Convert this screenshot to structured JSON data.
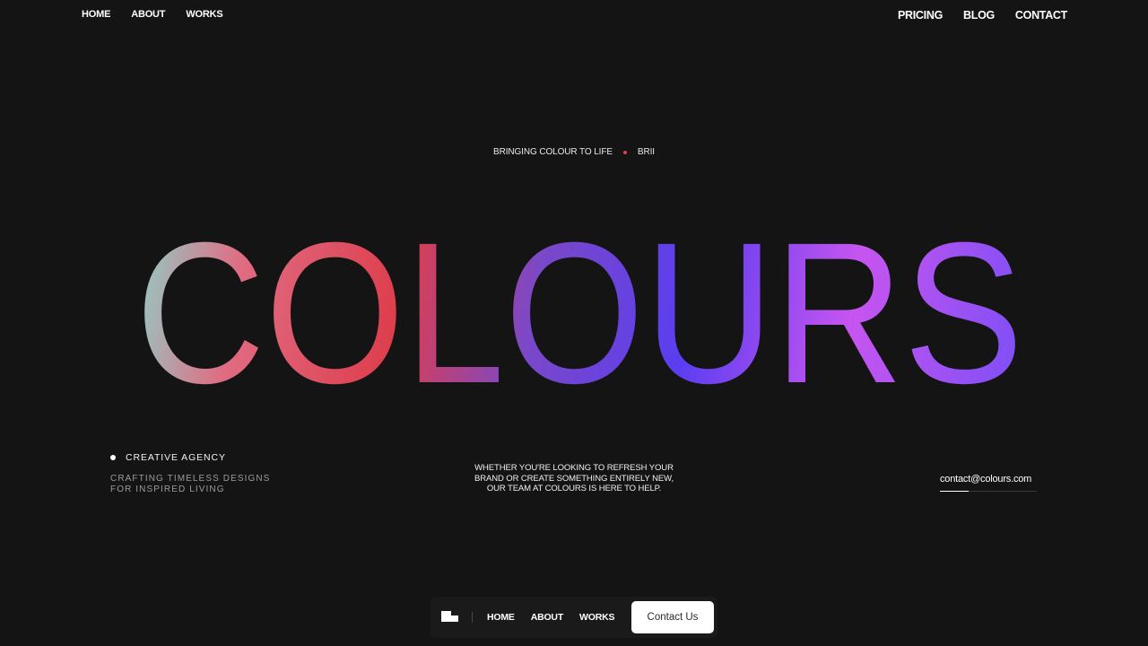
{
  "top_nav": {
    "left_links": [
      "HOME",
      "ABOUT",
      "WORKS"
    ],
    "right_links": [
      "PRICING",
      "BLOG",
      "CONTACT"
    ]
  },
  "hero": {
    "tagline_left": "BRINGING COLOUR TO LIFE",
    "tagline_right": "BRII",
    "tagline_dot_color": "#e63b4a",
    "word": "COLOURS",
    "gradient_colors": [
      "#8fd0c8",
      "#e06c82",
      "#dd3e4d",
      "#7a48c9",
      "#5b3ef0",
      "#c755f0",
      "#7c4ff5"
    ]
  },
  "agency": {
    "title": "CREATIVE AGENCY",
    "subtitle": "CRAFTING TIMELESS DESIGNS\nFOR INSPIRED LIVING"
  },
  "blurb": "WHETHER YOU'RE LOOKING TO REFRESH YOUR\nBRAND OR CREATE SOMETHING ENTIRELY NEW,\nOUR TEAM AT COLOURS IS HERE TO HELP.",
  "contact": {
    "email": "contact@colours.com",
    "underline_progress": 0.3
  },
  "bottom_bar": {
    "logo_icon": "colours-logo-icon",
    "links": [
      "HOME",
      "ABOUT",
      "WORKS"
    ],
    "cta_label": "Contact Us"
  }
}
